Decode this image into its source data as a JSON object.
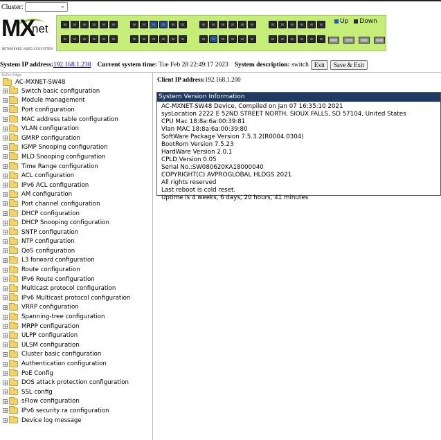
{
  "cluster": {
    "label": "Cluster:",
    "selected": ""
  },
  "logo": {
    "mx": "MX",
    "net": "net",
    "tagline": "NETWORKED VIDEO ECOSYSTEM"
  },
  "legend": {
    "up": "Up",
    "down": "Down",
    "up_color": "#1f5bb5",
    "down_color": "#2a2a2a"
  },
  "ports": {
    "top_up": [
      9,
      10,
      26,
      27,
      28
    ],
    "bottom_up": [
      8,
      23,
      38
    ]
  },
  "system": {
    "ip_label": "System IP address:",
    "ip": "192.168.1.238",
    "time_label": "Current system time:",
    "time": "Tue Feb 28 22:49:17 2023",
    "desc_label": "System description:",
    "desc": "switch",
    "exit_label": "Exit",
    "save_exit_label": "Save & Exit"
  },
  "tree": {
    "caption": "AVPro Edge",
    "root": "AC-MXNET-SW48",
    "items": [
      "Switch basic configuration",
      "Module management",
      "Port configuration",
      "MAC address table configuration",
      "VLAN configuration",
      "GMRP configuration",
      "IGMP Snooping configuration",
      "MLD Snooping configuration",
      "Time Range configuration",
      "ACL configuration",
      "IPv6 ACL configuration",
      "AM configuration",
      "Port channel configuration",
      "DHCP configuration",
      "DHCP Snooping configuration",
      "SNTP configuration",
      "NTP configuration",
      "QoS configuration",
      "L3 forward configuration",
      "Route configuration",
      "IPv6 Route configuration",
      "Multicast protocol configuration",
      "IPv6 Multicast protocol configuration",
      "VRRP configuration",
      "Spanning-tree configuration",
      "MRPP configuration",
      "ULPP configuration",
      "ULSM configuration",
      "Cluster basic configuration",
      "Authentication configuration",
      "PoE Config",
      "DOS attack protection configuration",
      "SSL config",
      "sFlow configuration",
      "IPv6 security ra configuration",
      "Device log message"
    ]
  },
  "client": {
    "label": "Client IP address:",
    "ip": "192.168.1.200"
  },
  "version": {
    "title": "System Version Information",
    "lines": [
      "AC-MXNET-SW48 Device, Compiled on Jan 07 16:35:10 2021",
      "sysLocation 2222 E 52ND STREET NORTH, SIOUX FALLS, SD 57104, United States",
      "CPU Mac 18:8a:6a:00:39:81",
      "Vlan MAC 18:8a:6a:00:39:80",
      "SoftWare Package Version 7.5.3.2(R0004.0304)",
      "BootRom Version 7.5.23",
      "HardWare Version 2.0.1",
      "CPLD Version 0.05",
      "Serial No.:SW080620KA18000040",
      "COPYRIGHT(C) AVPROGLOBAL HLDGS 2021",
      "All rights reserved",
      "Last reboot is cold reset.",
      "Uptime is 4 weeks, 6 days, 20 hours, 41 minutes"
    ]
  }
}
